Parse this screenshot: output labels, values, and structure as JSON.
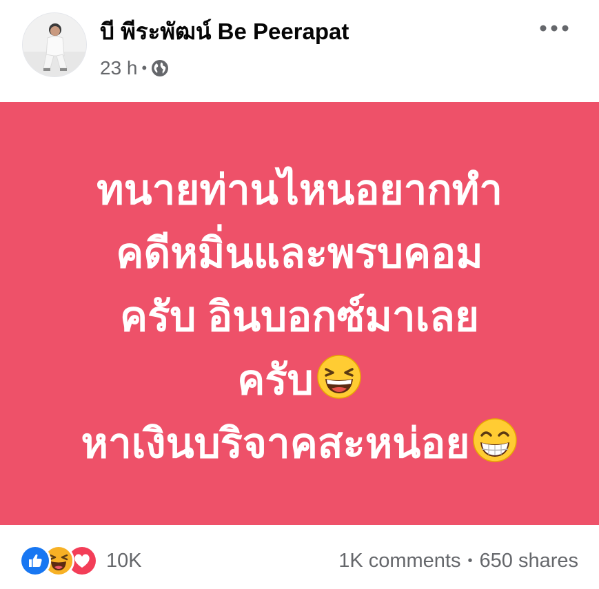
{
  "post": {
    "author": "บี พีระพัฒน์ Be Peerapat",
    "time": "23 h",
    "meta_separator": "•",
    "privacy_icon": "globe-icon",
    "more_icon": "more-options-icon",
    "banner_background": "#ee5169",
    "banner_lines": [
      "ทนายท่านไหนอยากทำ",
      "คดีหมิ่นและพรบคอม",
      "ครับ อินบอกซ์มาเลย",
      "ครับ",
      "หาเงินบริจาคสะหน่อย"
    ],
    "banner_emojis": [
      "grinning-squinting-face",
      "beaming-face-with-smiling-eyes"
    ]
  },
  "footer": {
    "reaction_icons": [
      "like-icon",
      "haha-icon",
      "love-icon"
    ],
    "reaction_count": "10K",
    "comments": "1K comments",
    "stats_separator": "•",
    "shares": "650 shares"
  },
  "colors": {
    "like": "#1877f2",
    "love": "#f33e58",
    "haha": "#f7b125",
    "meta_text": "#65676b"
  }
}
